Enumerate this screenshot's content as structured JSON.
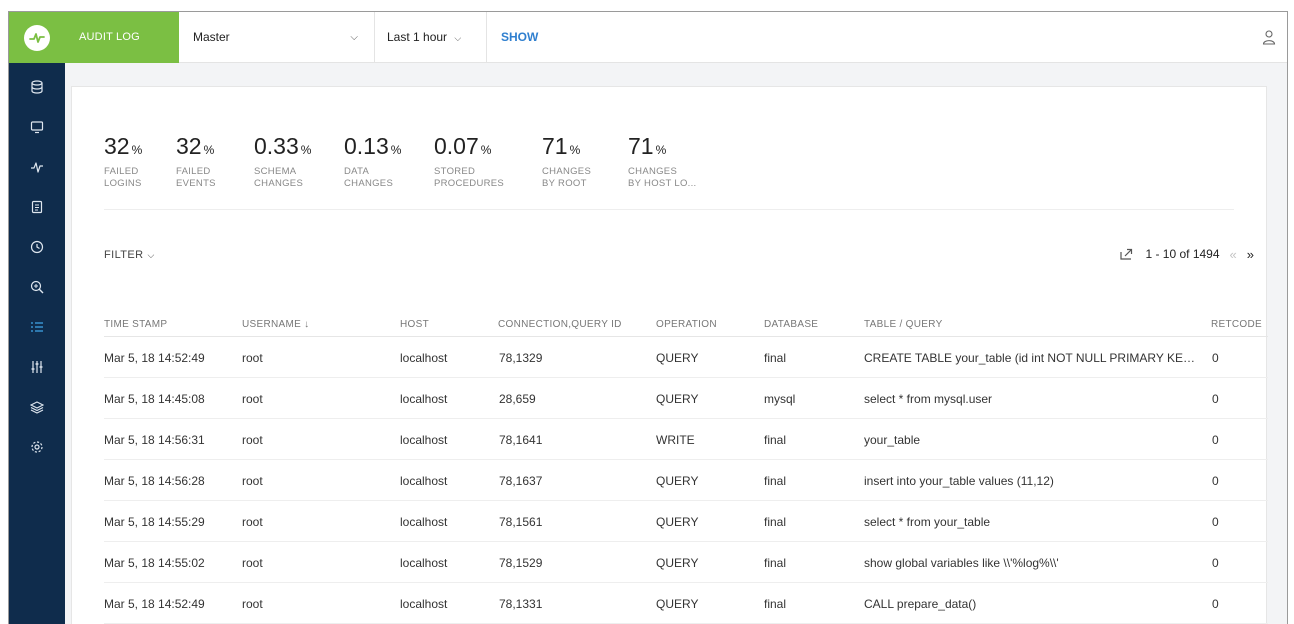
{
  "topbar": {
    "module_label": "AUDIT LOG",
    "server_value": "Master",
    "time_range_value": "Last 1 hour",
    "show_label": "SHOW"
  },
  "sidebar": {
    "items": [
      {
        "icon": "database-icon"
      },
      {
        "icon": "monitor-icon"
      },
      {
        "icon": "activity-icon"
      },
      {
        "icon": "document-icon"
      },
      {
        "icon": "clock-icon"
      },
      {
        "icon": "zoom-icon"
      },
      {
        "icon": "list-icon",
        "active": true
      },
      {
        "icon": "sliders-icon"
      },
      {
        "icon": "layers-icon"
      },
      {
        "icon": "settings-icon"
      }
    ]
  },
  "stats": [
    {
      "value": "32",
      "unit": "%",
      "label_1": "FAILED",
      "label_2": "LOGINS"
    },
    {
      "value": "32",
      "unit": "%",
      "label_1": "FAILED",
      "label_2": "EVENTS"
    },
    {
      "value": "0.33",
      "unit": "%",
      "label_1": "SCHEMA",
      "label_2": "CHANGES"
    },
    {
      "value": "0.13",
      "unit": "%",
      "label_1": "DATA",
      "label_2": "CHANGES"
    },
    {
      "value": "0.07",
      "unit": "%",
      "label_1": "STORED",
      "label_2": "PROCEDURES"
    },
    {
      "value": "71",
      "unit": "%",
      "label_1": "CHANGES",
      "label_2": "BY ROOT"
    },
    {
      "value": "71",
      "unit": "%",
      "label_1": "CHANGES",
      "label_2": "BY HOST LO..."
    }
  ],
  "filter_label": "FILTER",
  "pagination": {
    "range_text": "1 - 10 of 1494",
    "prev_symbol": "«",
    "next_symbol": "»"
  },
  "table": {
    "columns": [
      "TIME STAMP",
      "USERNAME ↓",
      "HOST",
      "CONNECTION,QUERY ID",
      "OPERATION",
      "DATABASE",
      "TABLE / QUERY",
      "RETCODE"
    ],
    "rows": [
      [
        "Mar 5, 18 14:52:49",
        "root",
        "localhost",
        "78,1329",
        "QUERY",
        "final",
        "CREATE TABLE your_table (id int NOT NULL PRIMARY KEY, value int)",
        "0"
      ],
      [
        "Mar 5, 18 14:45:08",
        "root",
        "localhost",
        "28,659",
        "QUERY",
        "mysql",
        "select * from mysql.user",
        "0"
      ],
      [
        "Mar 5, 18 14:56:31",
        "root",
        "localhost",
        "78,1641",
        "WRITE",
        "final",
        "your_table",
        "0"
      ],
      [
        "Mar 5, 18 14:56:28",
        "root",
        "localhost",
        "78,1637",
        "QUERY",
        "final",
        "insert into your_table values (11,12)",
        "0"
      ],
      [
        "Mar 5, 18 14:55:29",
        "root",
        "localhost",
        "78,1561",
        "QUERY",
        "final",
        "select * from your_table",
        "0"
      ],
      [
        "Mar 5, 18 14:55:02",
        "root",
        "localhost",
        "78,1529",
        "QUERY",
        "final",
        "show global variables like \\\\'%log%\\\\'",
        "0"
      ],
      [
        "Mar 5, 18 14:52:49",
        "root",
        "localhost",
        "78,1331",
        "QUERY",
        "final",
        "CALL prepare_data()",
        "0"
      ]
    ]
  },
  "colors": {
    "brand_green": "#7bbf43",
    "sidebar_bg": "#0f2c4c",
    "link_blue": "#2f7fcf",
    "active_icon": "#3a9ad9"
  }
}
